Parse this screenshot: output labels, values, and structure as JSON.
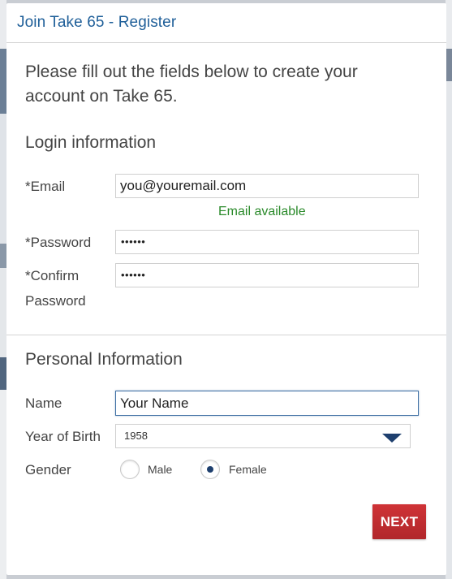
{
  "modal": {
    "title": "Join Take 65 - Register",
    "intro": "Please fill out the fields below to create your account on Take 65."
  },
  "login": {
    "section_title": "Login information",
    "email_label": "*Email",
    "email_value": "you@youremail.com",
    "email_status": "Email available",
    "password_label": "*Password",
    "password_value": "••••••",
    "confirm_label_line1": "*Confirm",
    "confirm_label_line2": "Password",
    "confirm_value": "••••••"
  },
  "personal": {
    "section_title": "Personal Information",
    "name_label": "Name",
    "name_value": "Your Name",
    "yob_label": "Year of Birth",
    "yob_value": "1958",
    "gender_label": "Gender",
    "gender_options": [
      "Male",
      "Female"
    ],
    "gender_selected": "Female"
  },
  "actions": {
    "next_label": "NEXT"
  },
  "colors": {
    "title": "#1f5f99",
    "status_ok": "#2a8a2a",
    "accent": "#1e3f6e",
    "button": "#c12d31"
  }
}
